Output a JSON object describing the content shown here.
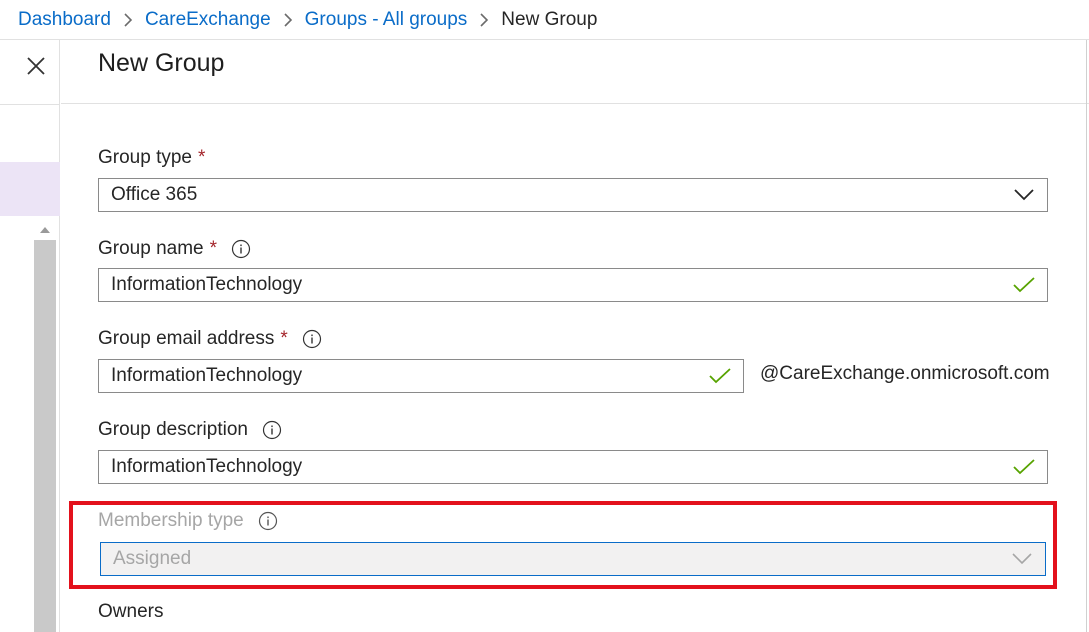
{
  "breadcrumb": {
    "items": [
      "Dashboard",
      "CareExchange",
      "Groups - All groups"
    ],
    "current": "New Group"
  },
  "blade": {
    "title": "New Group"
  },
  "form": {
    "group_type": {
      "label": "Group type",
      "required_mark": "*",
      "value": "Office 365"
    },
    "group_name": {
      "label": "Group name",
      "required_mark": "*",
      "value": "InformationTechnology"
    },
    "group_email": {
      "label": "Group email address",
      "required_mark": "*",
      "value": "InformationTechnology",
      "suffix": "@CareExchange.onmicrosoft.com"
    },
    "group_description": {
      "label": "Group description",
      "value": "InformationTechnology"
    },
    "membership_type": {
      "label": "Membership type",
      "value": "Assigned",
      "disabled": true
    },
    "owners": {
      "label": "Owners"
    }
  },
  "colors": {
    "link": "#0a6cc8",
    "required": "#a4262c",
    "valid_check": "#57a300",
    "highlight_box": "#e3111c",
    "left_highlight": "#ece4f6"
  },
  "icons": [
    "chevron-right-icon",
    "close-icon",
    "info-icon",
    "chevron-down-icon",
    "checkmark-icon",
    "scroll-up-arrow-icon"
  ]
}
